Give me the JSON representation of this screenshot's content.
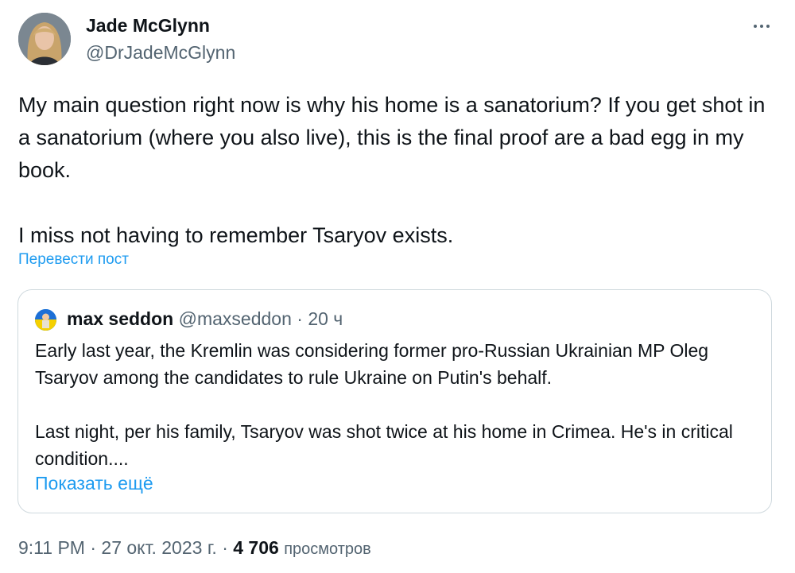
{
  "author": {
    "name": "Jade McGlynn",
    "handle": "@DrJadeMcGlynn"
  },
  "tweet": {
    "paragraphs": [
      "My main question right now is why his home is a sanatorium? If you get shot in a sanatorium (where you also live), this is the final proof are a bad egg in my book.",
      "I miss not having to remember Tsaryov exists."
    ],
    "translate_label": "Перевести пост"
  },
  "quote": {
    "name": "max seddon",
    "handle": "@maxseddon",
    "separator": "·",
    "time": "20 ч",
    "paragraphs": [
      "Early last year, the Kremlin was considering former pro-Russian Ukrainian MP Oleg Tsaryov among the candidates to rule Ukraine on Putin's behalf.",
      "Last night, per his family, Tsaryov was shot twice at his home in Crimea. He's in critical condition...."
    ],
    "show_more_label": "Показать ещё"
  },
  "meta": {
    "time": "9:11 PM",
    "sep1": "·",
    "date": "27 окт. 2023 г.",
    "sep2": "·",
    "views_count": "4 706",
    "views_label": "просмотров"
  },
  "colors": {
    "link": "#1d9bf0",
    "secondary_text": "#536471",
    "primary_text": "#0f1419",
    "border": "#cfd9de"
  },
  "icons": {
    "more": "more-horizontal-icon"
  }
}
